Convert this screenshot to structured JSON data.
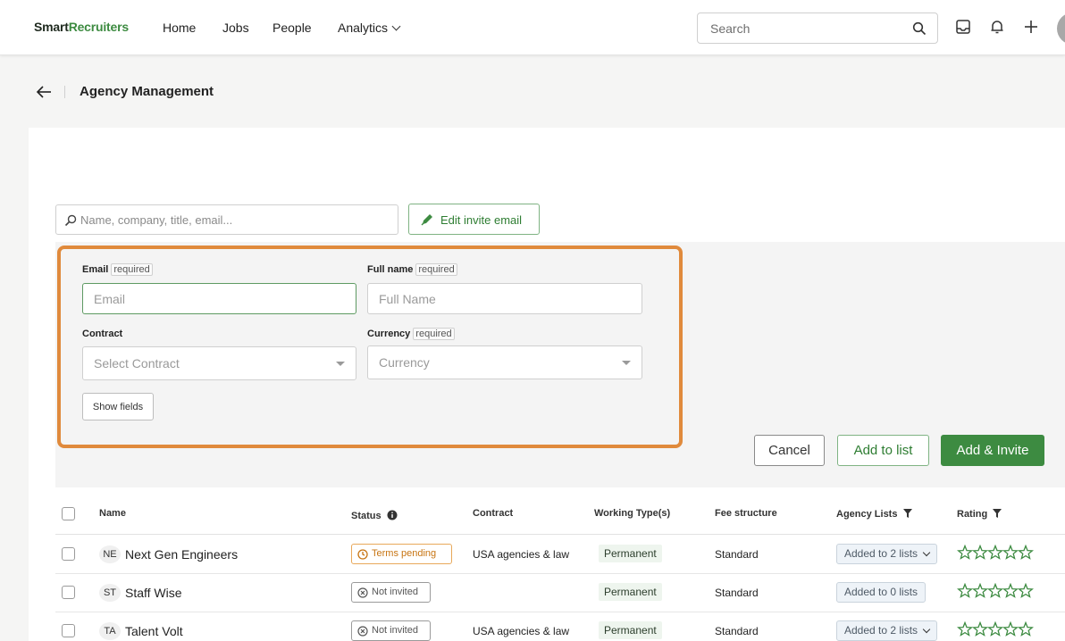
{
  "topbar": {
    "logo_part1": "Smart",
    "logo_part2": "Recruiters",
    "nav": [
      "Home",
      "Jobs",
      "People",
      "Analytics"
    ],
    "search_placeholder": "Search"
  },
  "page": {
    "title": "Agency Management"
  },
  "toolbar": {
    "search_placeholder": "Name, company, title, email...",
    "edit_invite_label": "Edit invite email"
  },
  "form": {
    "email_label": "Email",
    "email_required": "required",
    "email_placeholder": "Email",
    "fullname_label": "Full name",
    "fullname_required": "required",
    "fullname_placeholder": "Full Name",
    "contract_label": "Contract",
    "contract_placeholder": "Select Contract",
    "currency_label": "Currency",
    "currency_required": "required",
    "currency_placeholder": "Currency",
    "show_fields_label": "Show fields"
  },
  "actions": {
    "cancel": "Cancel",
    "add_to_list": "Add to list",
    "add_invite": "Add & Invite"
  },
  "table": {
    "headers": {
      "name": "Name",
      "status": "Status",
      "contract": "Contract",
      "working_types": "Working Type(s)",
      "fee": "Fee structure",
      "lists": "Agency Lists",
      "rating": "Rating"
    },
    "rows": [
      {
        "initials": "NE",
        "name": "Next Gen Engineers",
        "status": "Terms pending",
        "contract": "USA agencies & law",
        "working_type": "Permanent",
        "fee": "Standard",
        "lists": "Added to 2 lists",
        "stars": "☆☆☆☆☆"
      },
      {
        "initials": "ST",
        "name": "Staff Wise",
        "status": "Not invited",
        "contract": "",
        "working_type": "Permanent",
        "fee": "Standard",
        "lists": "Added to 0 lists",
        "stars": "☆☆☆☆☆"
      },
      {
        "initials": "TA",
        "name": "Talent Volt",
        "status": "Not invited",
        "contract": "USA agencies & law",
        "working_type": "Permanent",
        "fee": "Standard",
        "lists": "Added to 2 lists",
        "stars": "☆☆☆☆☆"
      }
    ]
  },
  "colors": {
    "brand_green": "#3d8b41",
    "highlight_orange": "#e08a3c",
    "pending_orange": "#c77412"
  }
}
